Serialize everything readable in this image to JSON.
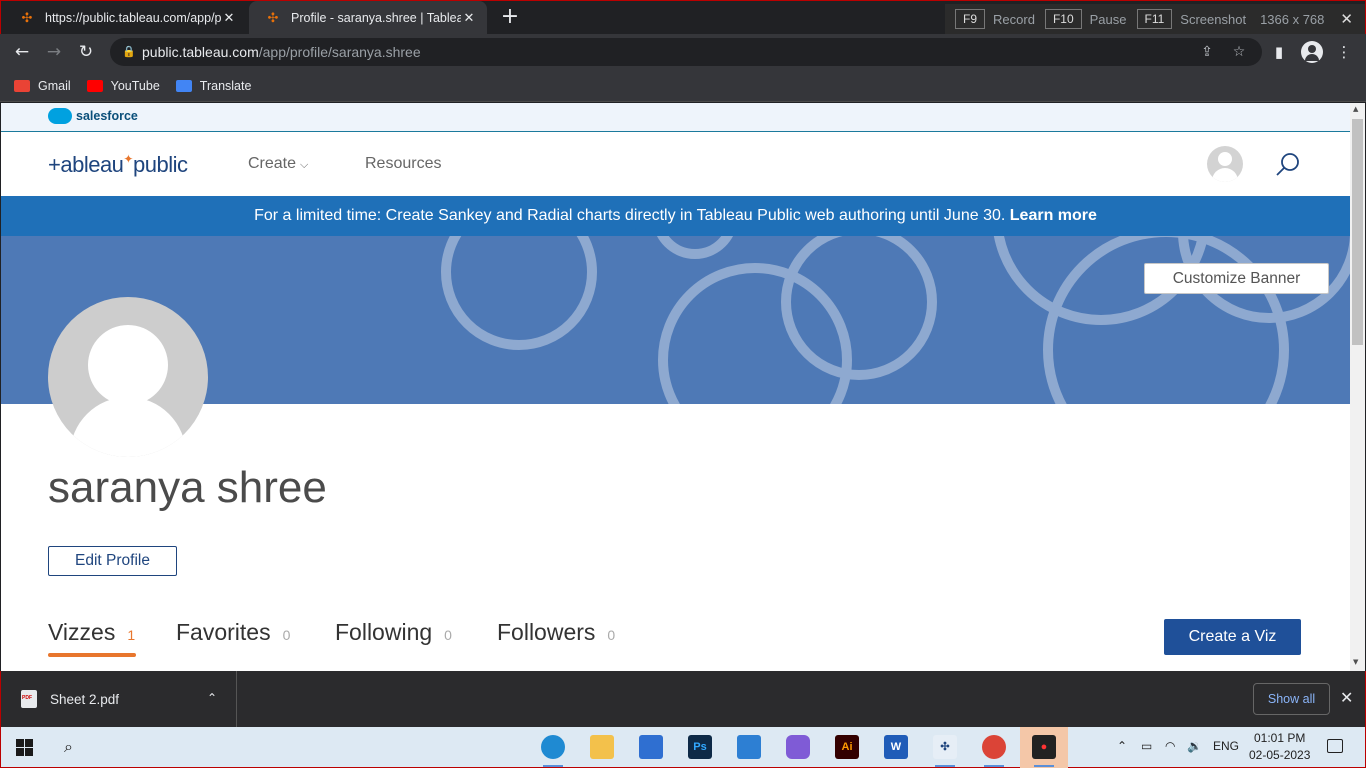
{
  "browser": {
    "tabs": [
      {
        "title": "https://public.tableau.com/app/p",
        "close": "✕"
      },
      {
        "title": "Profile - saranya.shree | Tableau P",
        "close": "✕"
      }
    ],
    "new_tab": "+",
    "recorder": {
      "f9": "F9",
      "record": "Record",
      "f10": "F10",
      "pause": "Pause",
      "f11": "F11",
      "screenshot": "Screenshot",
      "dims": "1366 x 768",
      "close": "✕"
    },
    "address": {
      "host": "public.tableau.com",
      "path": "/app/profile/saranya.shree"
    },
    "bookmarks": [
      {
        "label": "Gmail",
        "color": "#ea4335"
      },
      {
        "label": "YouTube",
        "color": "#ff0000"
      },
      {
        "label": "Translate",
        "color": "#4285f4"
      }
    ]
  },
  "page": {
    "salesforce_label": "salesforce",
    "logo": {
      "pre": "+ableau",
      "star": "✦",
      "post": "public"
    },
    "nav": {
      "create": "Create",
      "resources": "Resources"
    },
    "promo": {
      "text": "For a limited time: Create Sankey and Radial charts directly in Tableau Public web authoring until June 30. ",
      "link": "Learn more"
    },
    "customize_banner": "Customize Banner",
    "profile_name": "saranya shree",
    "edit_profile": "Edit Profile",
    "tabs": [
      {
        "label": "Vizzes",
        "count": "1"
      },
      {
        "label": "Favorites",
        "count": "0"
      },
      {
        "label": "Following",
        "count": "0"
      },
      {
        "label": "Followers",
        "count": "0"
      }
    ],
    "create_viz": "Create a Viz",
    "colors": {
      "brand_blue": "#1f457e",
      "promo_blue": "#1f70b8",
      "banner_blue": "#4e79b6",
      "accent_orange": "#e8762d"
    }
  },
  "downloads": {
    "file": "Sheet 2.pdf",
    "show_all": "Show all"
  },
  "taskbar": {
    "lang": "ENG",
    "time": "01:01 PM",
    "date": "02-05-2023"
  }
}
